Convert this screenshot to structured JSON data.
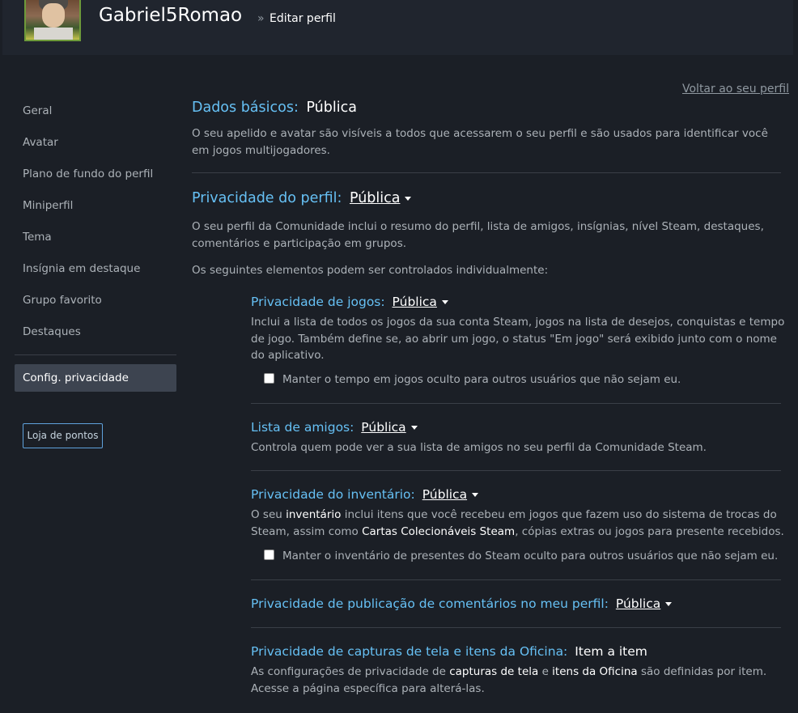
{
  "header": {
    "username": "Gabriel5Romao",
    "crumb_sep": "»",
    "crumb_page": "Editar perfil"
  },
  "sidebar": {
    "items": [
      {
        "label": "Geral"
      },
      {
        "label": "Avatar"
      },
      {
        "label": "Plano de fundo do perfil"
      },
      {
        "label": "Miniperfil"
      },
      {
        "label": "Tema"
      },
      {
        "label": "Insígnia em destaque"
      },
      {
        "label": "Grupo favorito"
      },
      {
        "label": "Destaques"
      }
    ],
    "active": "Config. privacidade",
    "points_button": "Loja de pontos"
  },
  "back_link": "Voltar ao seu perfil",
  "basic": {
    "label": "Dados básicos:",
    "value": "Pública",
    "desc": "O seu apelido e avatar são visíveis a todos que acessarem o seu perfil e são usados para identificar você em jogos multijogadores."
  },
  "profile": {
    "label": "Privacidade do perfil:",
    "value": "Pública",
    "desc": "O seu perfil da Comunidade inclui o resumo do perfil, lista de amigos, insígnias, nível Steam, destaques, comentários e participação em grupos.",
    "desc2": "Os seguintes elementos podem ser controlados individualmente:"
  },
  "games": {
    "label": "Privacidade de jogos:",
    "value": "Pública",
    "desc": "Inclui a lista de todos os jogos da sua conta Steam, jogos na lista de desejos, conquistas e tempo de jogo. Também define se, ao abrir um jogo, o status \"Em jogo\" será exibido junto com o nome do aplicativo.",
    "checkbox": "Manter o tempo em jogos oculto para outros usuários que não sejam eu."
  },
  "friends": {
    "label": "Lista de amigos:",
    "value": "Pública",
    "desc": "Controla quem pode ver a sua lista de amigos no seu perfil da Comunidade Steam."
  },
  "inventory": {
    "label": "Privacidade do inventário:",
    "value": "Pública",
    "desc_1": "O seu ",
    "desc_b1": "inventário",
    "desc_2": " inclui itens que você recebeu em jogos que fazem uso do sistema de trocas do Steam, assim como ",
    "desc_b2": "Cartas Colecionáveis Steam",
    "desc_3": ", cópias extras ou jogos para presente recebidos.",
    "checkbox": "Manter o inventário de presentes do Steam oculto para outros usuários que não sejam eu."
  },
  "comments": {
    "label": "Privacidade de publicação de comentários no meu perfil:",
    "value": "Pública"
  },
  "screenshots": {
    "label": "Privacidade de capturas de tela e itens da Oficina:",
    "value": "Item a item",
    "desc_1": "As configurações de privacidade de ",
    "desc_b1": "capturas de tela",
    "desc_2": " e ",
    "desc_b2": "itens da Oficina",
    "desc_3": " são definidas por item. Acesse a página específica para alterá-las."
  }
}
